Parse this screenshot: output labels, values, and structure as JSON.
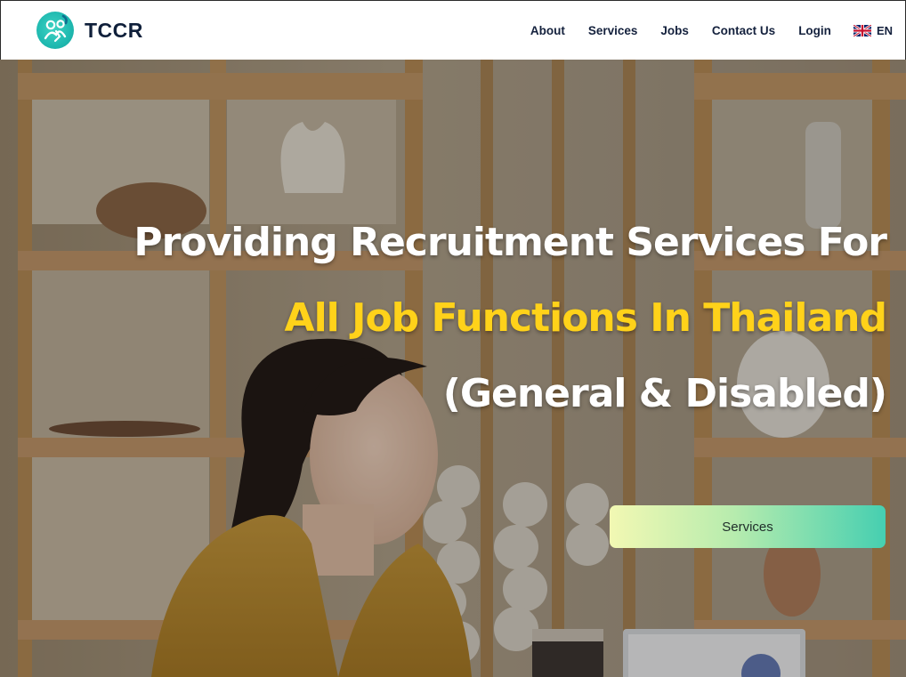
{
  "header": {
    "brand": "TCCR",
    "logo_icon": "puzzle-people-logo",
    "nav": [
      {
        "id": "about",
        "label": "About"
      },
      {
        "id": "services",
        "label": "Services"
      },
      {
        "id": "jobs",
        "label": "Jobs"
      },
      {
        "id": "contact",
        "label": "Contact Us"
      },
      {
        "id": "login",
        "label": "Login"
      }
    ],
    "language": {
      "label": "EN",
      "icon": "uk-flag-icon"
    }
  },
  "hero": {
    "headline_line1": "Providing Recruitment Services For",
    "headline_line2": "All Job Functions In Thailand",
    "headline_line3": "(General & Disabled)",
    "cta_label": "Services",
    "background": "woman-smiling-office-shelves-photo"
  },
  "colors": {
    "accent_yellow": "#ffd21a",
    "brand_teal": "#1fb9b0",
    "nav_text": "#14213d",
    "cta_gradient_start": "#f2f8b3",
    "cta_gradient_end": "#46cfb0"
  }
}
